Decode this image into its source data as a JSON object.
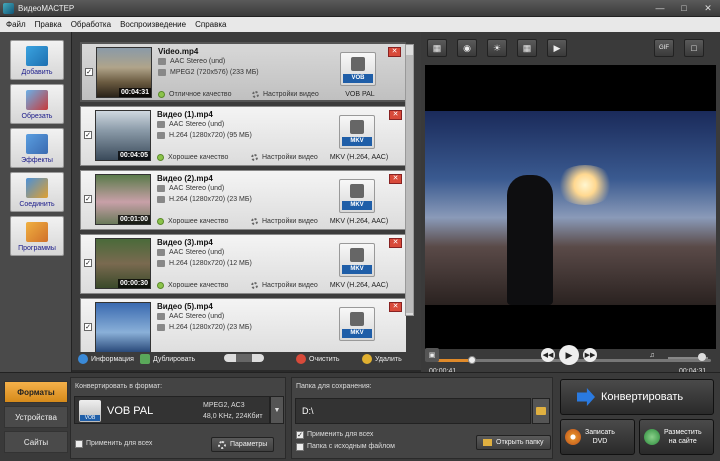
{
  "window": {
    "title": "ВидеоМАСТЕР",
    "minimize_icon": "minimize-icon",
    "maximize_icon": "maximize-icon",
    "close_icon": "close-icon"
  },
  "menu": [
    "Файл",
    "Правка",
    "Обработка",
    "Воспроизведение",
    "Справка"
  ],
  "tools": [
    {
      "label": "Добавить",
      "icon": "add-file-icon"
    },
    {
      "label": "Обрезать",
      "icon": "cut-icon"
    },
    {
      "label": "Эффекты",
      "icon": "effects-icon"
    },
    {
      "label": "Соединить",
      "icon": "join-icon"
    },
    {
      "label": "Программы",
      "icon": "programs-icon"
    }
  ],
  "files": [
    {
      "name": "Video.mp4",
      "audio": "AAC Stereo (und)",
      "video": "MPEG2 (720x576) (233 МБ)",
      "quality": "Отличное качество",
      "settings": "Настройки видео",
      "format_badge": "VOB",
      "format_label": "VOB PAL",
      "duration": "00:04:31",
      "checked": true,
      "selected": true
    },
    {
      "name": "Видео (1).mp4",
      "audio": "AAC Stereo (und)",
      "video": "H.264 (1280x720) (95 МБ)",
      "quality": "Хорошее качество",
      "settings": "Настройки видео",
      "format_badge": "MKV",
      "format_label": "MKV (H.264, AAC)",
      "duration": "00:04:05",
      "checked": true,
      "selected": false
    },
    {
      "name": "Видео (2).mp4",
      "audio": "AAC Stereo (und)",
      "video": "H.264 (1280x720) (23 МБ)",
      "quality": "Хорошее качество",
      "settings": "Настройки видео",
      "format_badge": "MKV",
      "format_label": "MKV (H.264, AAC)",
      "duration": "00:01:00",
      "checked": true,
      "selected": false
    },
    {
      "name": "Видео (3).mp4",
      "audio": "AAC Stereo (und)",
      "video": "H.264 (1280x720) (12 МБ)",
      "quality": "Хорошее качество",
      "settings": "Настройки видео",
      "format_badge": "MKV",
      "format_label": "MKV (H.264, AAC)",
      "duration": "00:00:30",
      "checked": true,
      "selected": false
    },
    {
      "name": "Видео (5).mp4",
      "audio": "AAC Stereo (und)",
      "video": "H.264 (1280x720) (23 МБ)",
      "quality": "",
      "settings": "",
      "format_badge": "MKV",
      "format_label": "",
      "duration": "",
      "checked": true,
      "selected": false
    }
  ],
  "listbar": {
    "info": "Информация",
    "duplicate": "Дублировать",
    "clear": "Очистить",
    "delete": "Удалить"
  },
  "preview_tools": [
    "crop-icon",
    "snapshot-icon",
    "brightness-icon",
    "film-icon",
    "speed-icon",
    "gif-icon",
    "fullscreen-icon"
  ],
  "preview": {
    "current_time": "00:00:41",
    "total_time": "00:04:31",
    "progress": 0.15,
    "gif_label": "GIF",
    "volume": 0.85
  },
  "bottom_tabs": [
    {
      "label": "Форматы",
      "active": true
    },
    {
      "label": "Устройства",
      "active": false
    },
    {
      "label": "Сайты",
      "active": false
    }
  ],
  "convert": {
    "heading": "Конвертировать в формат:",
    "format_badge": "VOB",
    "format_name": "VOB PAL",
    "spec_line1": "MPEG2, AC3",
    "spec_line2": "48,0 KHz, 224Кбит",
    "apply_all": "Применить для всех",
    "params_button": "Параметры"
  },
  "save": {
    "heading": "Папка для сохранения:",
    "path": "D:\\",
    "apply_all": "Применить для всех",
    "same_folder": "Папка с исходным файлом",
    "open_folder": "Открыть папку"
  },
  "actions": {
    "convert": "Конвертировать",
    "burn_dvd": "Записать DVD",
    "burn_dvd_line1": "Записать",
    "burn_dvd_line2": "DVD",
    "publish_line1": "Разместить",
    "publish_line2": "на сайте"
  },
  "colors": {
    "accent": "#e08a2a",
    "format_badge": "#1f5ea8",
    "tab_active": "#f5b14a"
  }
}
